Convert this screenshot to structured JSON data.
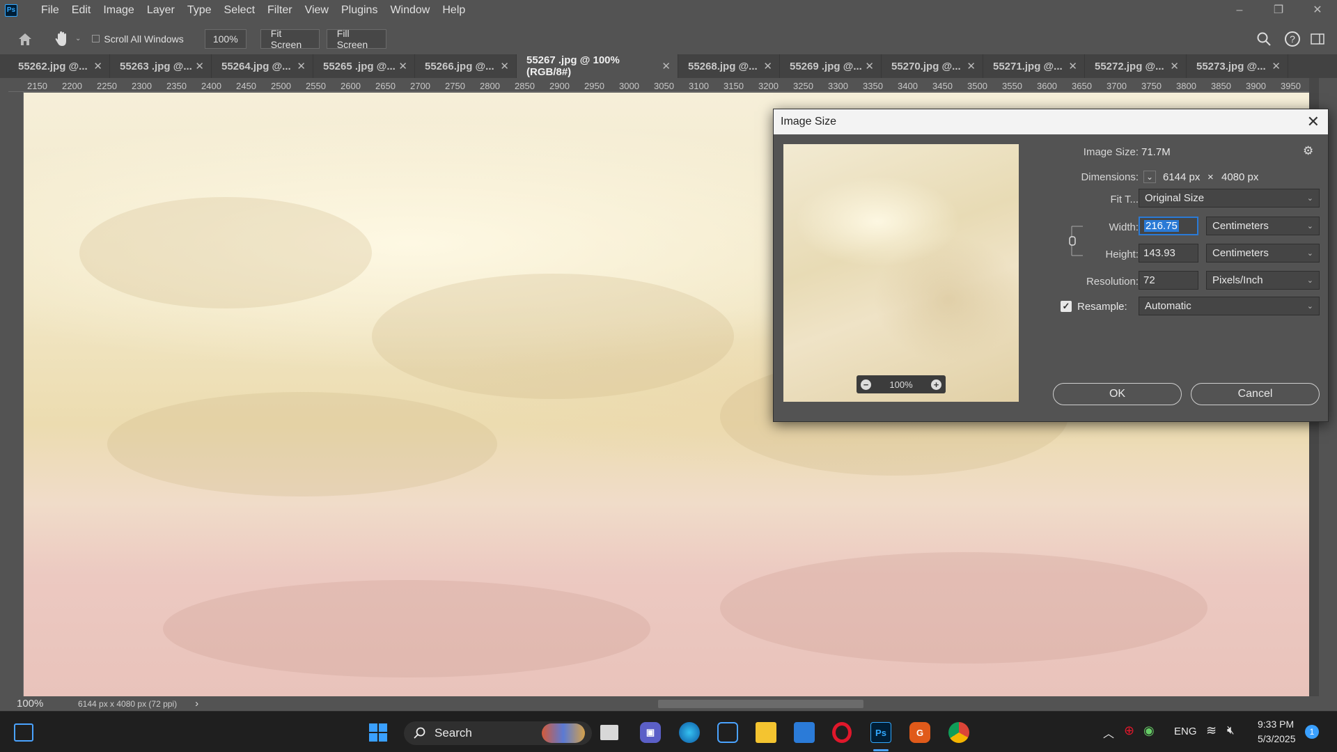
{
  "menubar": {
    "logo": "Ps",
    "items": [
      "File",
      "Edit",
      "Image",
      "Layer",
      "Type",
      "Select",
      "Filter",
      "View",
      "Plugins",
      "Window",
      "Help"
    ],
    "window_controls": [
      "–",
      "❐",
      "✕"
    ]
  },
  "options_bar": {
    "scroll_all_windows": "Scroll All Windows",
    "zoom": "100%",
    "fit_screen": "Fit Screen",
    "fill_screen": "Fill Screen"
  },
  "tabs": [
    "55262.jpg @...",
    "55263 .jpg @...",
    "55264.jpg @...",
    "55265 .jpg @...",
    "55266.jpg @...",
    "55267 .jpg @ 100% (RGB/8#)",
    "55268.jpg @...",
    "55269 .jpg @...",
    "55270.jpg @...",
    "55271.jpg @...",
    "55272.jpg @...",
    "55273.jpg @..."
  ],
  "active_tab_index": 5,
  "ruler_ticks": [
    "2150",
    "2200",
    "2250",
    "2300",
    "2350",
    "2400",
    "2450",
    "2500",
    "2550",
    "2600",
    "2650",
    "2700",
    "2750",
    "2800",
    "2850",
    "2900",
    "2950",
    "3000",
    "3050",
    "3100",
    "3150",
    "3200",
    "3250",
    "3300",
    "3350",
    "3400",
    "3450",
    "3500",
    "3550",
    "3600",
    "3650",
    "3700",
    "3750",
    "3800",
    "3850",
    "3900",
    "3950"
  ],
  "status": {
    "zoom": "100%",
    "doc_info": "6144 px x 4080 px (72 ppi)",
    "arrow": "›"
  },
  "dialog": {
    "title": "Image Size",
    "preview_zoom": "100%",
    "image_size_label": "Image Size:",
    "image_size_value": "71.7M",
    "dimensions_label": "Dimensions:",
    "dimensions_w": "6144 px",
    "dimensions_x": "×",
    "dimensions_h": "4080 px",
    "fit_to_label": "Fit T...",
    "fit_to_value": "Original Size",
    "width_label": "Width:",
    "width_value": "216.75",
    "width_unit": "Centimeters",
    "height_label": "Height:",
    "height_value": "143.93",
    "height_unit": "Centimeters",
    "resolution_label": "Resolution:",
    "resolution_value": "72",
    "resolution_unit": "Pixels/Inch",
    "resample_label": "Resample:",
    "resample_checked": true,
    "resample_value": "Automatic",
    "ok": "OK",
    "cancel": "Cancel"
  },
  "taskbar": {
    "search_placeholder": "Search",
    "language": "ENG",
    "time": "9:33 PM",
    "date": "5/3/2025",
    "notification_count": "1"
  }
}
